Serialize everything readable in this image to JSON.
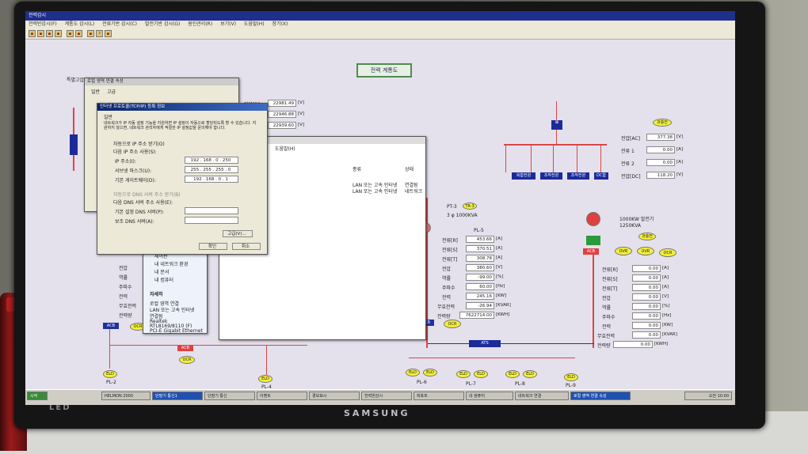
{
  "app": {
    "title": "전력감시",
    "menus": [
      "전력반감시(F)",
      "계통도 감시(L)",
      "전류기반 감시(C)",
      "발전기반 감시(G)",
      "원인관리(R)",
      "보기(V)",
      "도움말(H)",
      "창기(X)"
    ]
  },
  "diagram": {
    "title": "전력 계통도",
    "section_label": "특별고압",
    "voltage_top": [
      {
        "label": "전압[R]",
        "value": "22981.49",
        "unit": "[V]"
      },
      {
        "value": "22946.88",
        "unit": "[V]"
      },
      {
        "value": "22939.60",
        "unit": "[V]"
      }
    ],
    "dc_panel": {
      "button": "과충전",
      "rows": [
        {
          "label": "전압[AC]",
          "value": "377.38",
          "unit": "[V]"
        },
        {
          "label": "전류 1",
          "value": "0.00",
          "unit": "[A]"
        },
        {
          "label": "전류 2",
          "value": "0.00",
          "unit": "[A]"
        },
        {
          "label": "전압[DC]",
          "value": "118.20",
          "unit": "[V]"
        }
      ],
      "feeders": [
        "복합전원",
        "조작전원",
        "조작전원",
        "DC함"
      ]
    },
    "tr3": {
      "name": "PT-3",
      "tag": "TR-3",
      "rating": "3 φ 1000KVA",
      "feeder": "PL-5"
    },
    "pl5_readings": [
      {
        "label": "전류[R]",
        "value": "453.66",
        "unit": "[A]"
      },
      {
        "label": "전류[S]",
        "value": "370.51",
        "unit": "[A]"
      },
      {
        "label": "전류[T]",
        "value": "308.78",
        "unit": "[A]"
      },
      {
        "label": "전압",
        "value": "380.60",
        "unit": "[V]"
      },
      {
        "label": "역률",
        "value": "-99.00",
        "unit": "[%]"
      },
      {
        "label": "주파수",
        "value": "60.00",
        "unit": "[Hz]"
      },
      {
        "label": "전력",
        "value": "245.16",
        "unit": "[KW]"
      },
      {
        "label": "무효전력",
        "value": "-26.94",
        "unit": "[KVAR]"
      },
      {
        "label": "전력량",
        "value": "7622714.00",
        "unit": "[KWH]"
      }
    ],
    "generator": {
      "rating": "1000KW 발전기",
      "kva": "1250KVA",
      "button": "과충전",
      "relays": [
        "OVR",
        "UVR",
        "OCR"
      ]
    },
    "gen_readings": [
      {
        "label": "전류[R]",
        "value": "0.00",
        "unit": "[A]"
      },
      {
        "label": "전류[S]",
        "value": "0.00",
        "unit": "[A]"
      },
      {
        "label": "전류[T]",
        "value": "0.00",
        "unit": "[A]"
      },
      {
        "label": "전압",
        "value": "0.00",
        "unit": "[V]"
      },
      {
        "label": "역률",
        "value": "0.00",
        "unit": "[%]"
      },
      {
        "label": "주파수",
        "value": "0.00",
        "unit": "[Hz]"
      },
      {
        "label": "전력",
        "value": "0.00",
        "unit": "[KW]"
      },
      {
        "label": "무효전력",
        "value": "0.00",
        "unit": "[KVAR]"
      },
      {
        "label": "전력량",
        "value": "0.00",
        "unit": "[KWH]"
      }
    ],
    "left_labels": [
      "전압",
      "역률",
      "주파수",
      "전력",
      "무효전력",
      "전력량"
    ],
    "acb": "ACB",
    "ocr": "OCR",
    "ats": "ATS",
    "eld": "ELD",
    "feeders": [
      "PL-2",
      "PL-4",
      "PL-6",
      "PL-7",
      "PL-8",
      "PL-9"
    ]
  },
  "dialog_lan": {
    "title": "로컬 영역 연결 속성",
    "tabs": [
      "일반",
      "고급"
    ]
  },
  "dialog_tcpip": {
    "title": "인터넷 프로토콜(TCP/IP) 등록 정보",
    "tab": "일반",
    "description": "네트워크가 IP 자동 설정 기능을 지원하면 IP 설정이 자동으로 할당되도록 할 수 있습니다. 지원하지 않으면, 네트워크 관리자에게 적절한 IP 설정값을 문의해야 합니다.",
    "radio_auto": "자동으로 IP 주소 받기(O)",
    "radio_manual": "다음 IP 주소 사용(S):",
    "ip_label": "IP 주소(I):",
    "ip_value": "192 . 168 . 0 . 250",
    "mask_label": "서브넷 마스크(U):",
    "mask_value": "255 . 255 . 255 . 0",
    "gw_label": "기본 게이트웨이(D):",
    "gw_value": "192 . 168 . 0 . 1",
    "dns_auto": "자동으로 DNS 서버 주소 받기(B)",
    "dns_manual": "다음 DNS 서버 주소 사용(E):",
    "dns1_label": "기본 설정 DNS 서버(P):",
    "dns2_label": "보조 DNS 서버(A):",
    "advanced": "고급(V)...",
    "ok": "확인",
    "cancel": "취소"
  },
  "netconn": {
    "menu": "도움말(H)",
    "headers": [
      "종류",
      "상태"
    ],
    "rows": [
      {
        "type": "LAN 또는 고속 인터넷",
        "status": "연결됨"
      },
      {
        "type": "LAN 또는 고속 인터넷",
        "status": "네트워크"
      }
    ]
  },
  "side_menu": {
    "items": [
      "제어판",
      "내 네트워크 환경",
      "내 문서",
      "내 컴퓨터"
    ],
    "detail_title": "자세히",
    "detail_lines": [
      "로컬 영역 연결",
      "LAN 또는 고속 인터넷",
      "연결됨",
      "Realtek",
      "RTL8169/8110 (F)",
      "PCI-E Gigabit Ethernet"
    ]
  },
  "taskbar": {
    "start": "시작",
    "items": [
      "HELMON 2000",
      "단말기 통신1",
      "단말기 통신",
      "이벤트",
      "경보표시",
      "전력반감시",
      "레포트",
      "내 컴퓨터",
      "네트워크 연결",
      "로컬 영역 연결 속성"
    ],
    "clock": "오전 10:00"
  },
  "bezel": {
    "brand": "SAMSUNG",
    "logo": "LED"
  }
}
